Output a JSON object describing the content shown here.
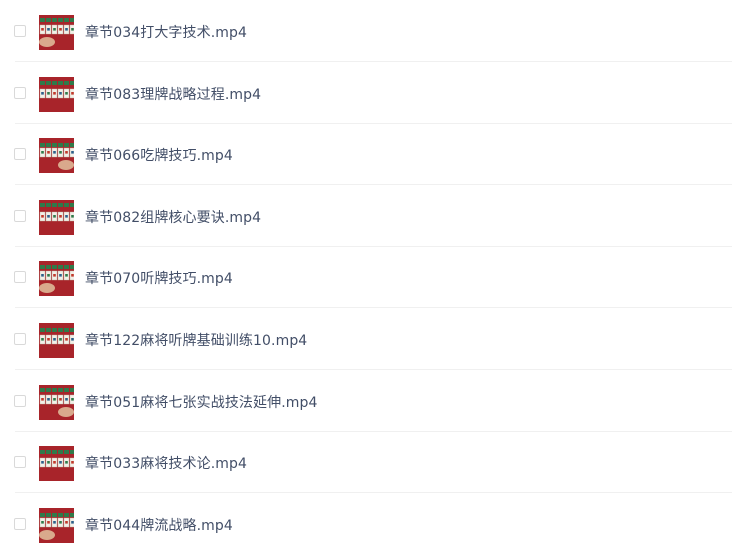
{
  "files": [
    {
      "name": "章节034打大字技术.mp4",
      "thumbnail_icon": "video-thumbnail-icon"
    },
    {
      "name": "章节083理牌战略过程.mp4",
      "thumbnail_icon": "video-thumbnail-icon"
    },
    {
      "name": "章节066吃牌技巧.mp4",
      "thumbnail_icon": "video-thumbnail-icon"
    },
    {
      "name": "章节082组牌核心要诀.mp4",
      "thumbnail_icon": "video-thumbnail-icon"
    },
    {
      "name": "章节070听牌技巧.mp4",
      "thumbnail_icon": "video-thumbnail-icon"
    },
    {
      "name": "章节122麻将听牌基础训练10.mp4",
      "thumbnail_icon": "video-thumbnail-icon"
    },
    {
      "name": "章节051麻将七张实战技法延伸.mp4",
      "thumbnail_icon": "video-thumbnail-icon"
    },
    {
      "name": "章节033麻将技术论.mp4",
      "thumbnail_icon": "video-thumbnail-icon"
    },
    {
      "name": "章节044牌流战略.mp4",
      "thumbnail_icon": "video-thumbnail-icon"
    }
  ],
  "colors": {
    "text": "#424e67",
    "checkbox_border": "#d9d9d9",
    "divider": "#f0f0f0",
    "thumb_table": "#a8242a",
    "thumb_tile": "#f2f0e8",
    "thumb_tile_back": "#2f7a4a"
  }
}
